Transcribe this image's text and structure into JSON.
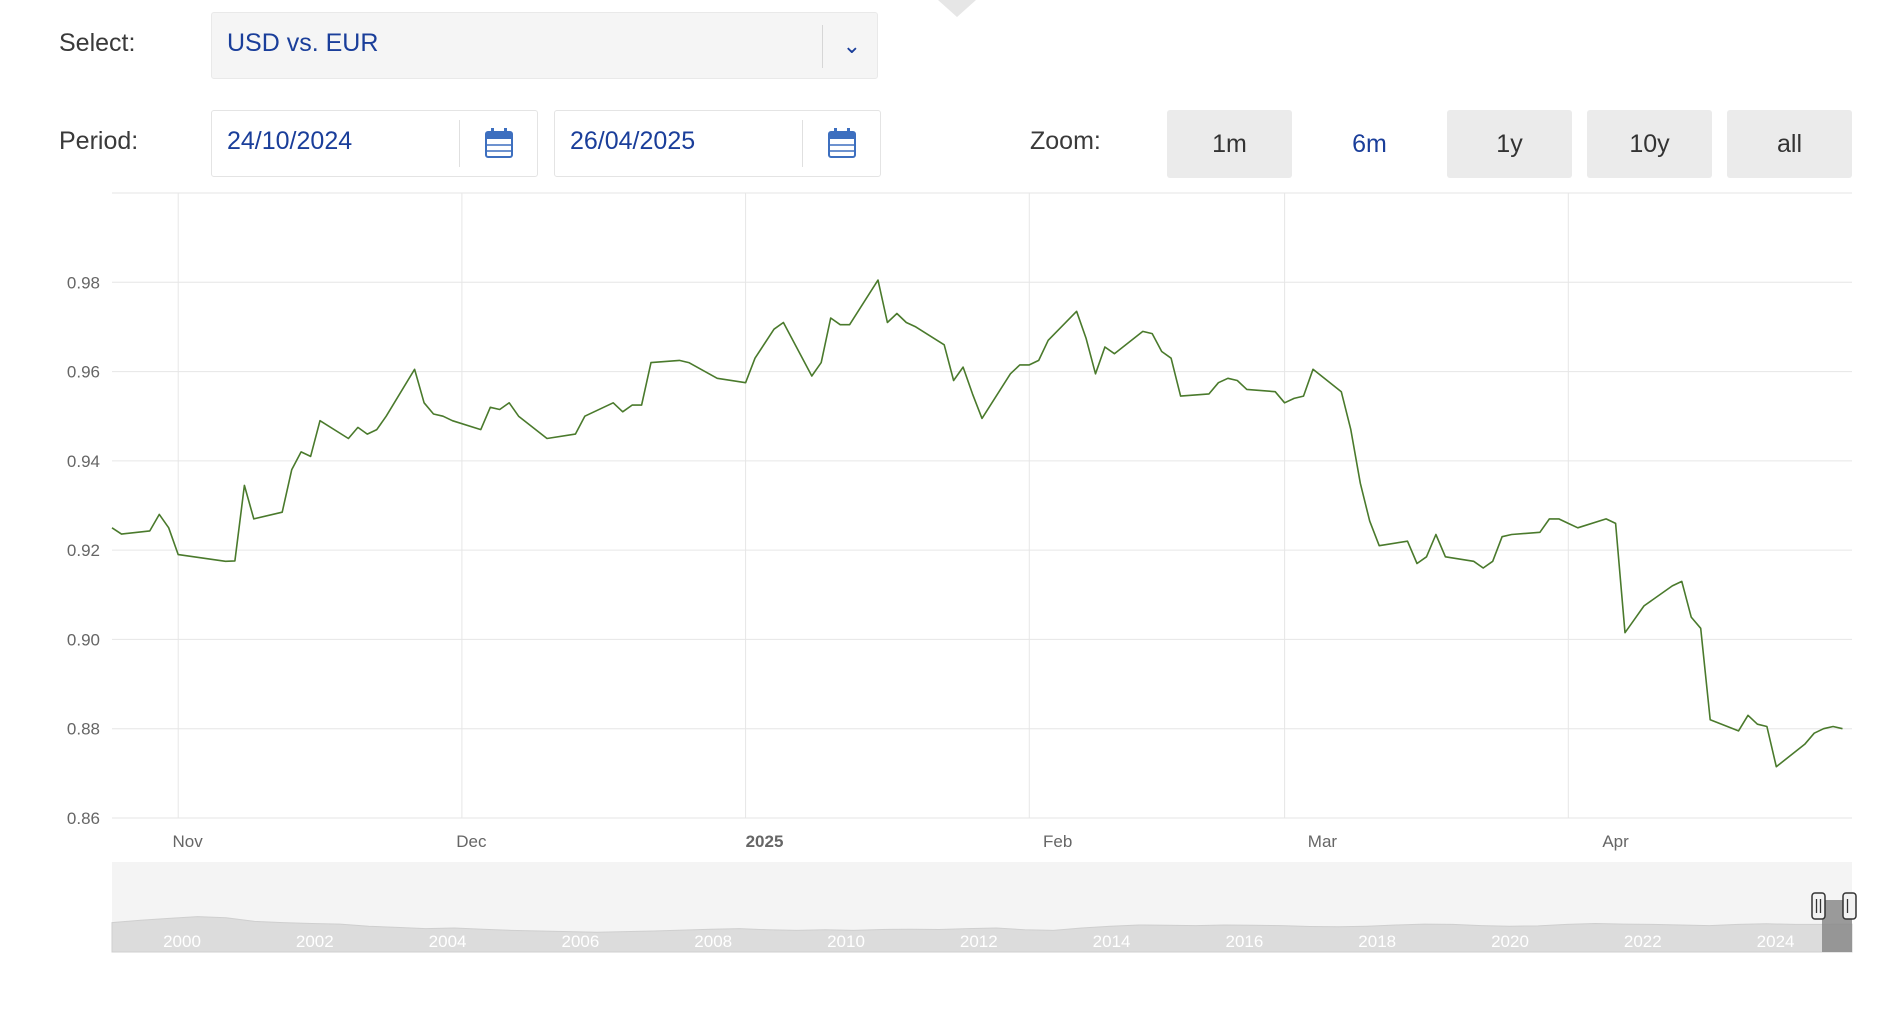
{
  "controls": {
    "select_label": "Select:",
    "select_value": "USD vs. EUR",
    "period_label": "Period:",
    "start_date": "24/10/2024",
    "end_date": "26/04/2025",
    "zoom_label": "Zoom:",
    "zoom_options": [
      "1m",
      "6m",
      "1y",
      "10y",
      "all"
    ],
    "zoom_selected": "6m"
  },
  "colors": {
    "line": "#4a7a2c",
    "accent": "#1a3e9a",
    "button_bg": "#ebebeb",
    "navigator_fill": "#dcdcdc"
  },
  "icons": [
    "chevron-down-icon",
    "calendar-icon"
  ],
  "chart_data": {
    "type": "line",
    "title": "",
    "xlabel": "",
    "ylabel": "",
    "ylim": [
      0.86,
      1.0
    ],
    "yticks": [
      "0.86",
      "0.88",
      "0.90",
      "0.92",
      "0.94",
      "0.96",
      "0.98"
    ],
    "xlim": [
      "2024-10-24",
      "2025-04-26"
    ],
    "xticks": [
      {
        "date": "2024-11-01",
        "label": "Nov",
        "bold": false
      },
      {
        "date": "2024-12-01",
        "label": "Dec",
        "bold": false
      },
      {
        "date": "2025-01-01",
        "label": "2025",
        "bold": true
      },
      {
        "date": "2025-02-01",
        "label": "Feb",
        "bold": false
      },
      {
        "date": "2025-03-01",
        "label": "Mar",
        "bold": false
      },
      {
        "date": "2025-04-01",
        "label": "Apr",
        "bold": false
      }
    ],
    "grid_dates": [
      "2024-10-31",
      "2024-11-30",
      "2024-12-30",
      "2025-01-29",
      "2025-02-25",
      "2025-03-27"
    ],
    "grid": true,
    "series": [
      {
        "x": [
          "2024-10-24",
          "2024-10-25",
          "2024-10-28",
          "2024-10-29",
          "2024-10-30",
          "2024-10-31",
          "2024-11-05",
          "2024-11-06",
          "2024-11-07",
          "2024-11-08",
          "2024-11-11",
          "2024-11-12",
          "2024-11-13",
          "2024-11-14",
          "2024-11-15",
          "2024-11-18",
          "2024-11-19",
          "2024-11-20",
          "2024-11-21",
          "2024-11-22",
          "2024-11-25",
          "2024-11-26",
          "2024-11-27",
          "2024-11-28",
          "2024-11-29",
          "2024-12-02",
          "2024-12-03",
          "2024-12-04",
          "2024-12-05",
          "2024-12-06",
          "2024-12-09",
          "2024-12-12",
          "2024-12-13",
          "2024-12-16",
          "2024-12-17",
          "2024-12-18",
          "2024-12-19",
          "2024-12-20",
          "2024-12-23",
          "2024-12-24",
          "2024-12-27",
          "2024-12-30",
          "2024-12-31",
          "2025-01-02",
          "2025-01-03",
          "2025-01-06",
          "2025-01-07",
          "2025-01-08",
          "2025-01-09",
          "2025-01-10",
          "2025-01-13",
          "2025-01-14",
          "2025-01-15",
          "2025-01-16",
          "2025-01-17",
          "2025-01-20",
          "2025-01-21",
          "2025-01-22",
          "2025-01-23",
          "2025-01-24",
          "2025-01-27",
          "2025-01-28",
          "2025-01-29",
          "2025-01-30",
          "2025-01-31",
          "2025-02-03",
          "2025-02-04",
          "2025-02-05",
          "2025-02-06",
          "2025-02-07",
          "2025-02-10",
          "2025-02-11",
          "2025-02-12",
          "2025-02-13",
          "2025-02-14",
          "2025-02-17",
          "2025-02-18",
          "2025-02-19",
          "2025-02-20",
          "2025-02-21",
          "2025-02-24",
          "2025-02-25",
          "2025-02-26",
          "2025-02-27",
          "2025-02-28",
          "2025-03-03",
          "2025-03-04",
          "2025-03-05",
          "2025-03-06",
          "2025-03-07",
          "2025-03-10",
          "2025-03-11",
          "2025-03-12",
          "2025-03-13",
          "2025-03-14",
          "2025-03-17",
          "2025-03-18",
          "2025-03-19",
          "2025-03-20",
          "2025-03-21",
          "2025-03-24",
          "2025-03-25",
          "2025-03-26",
          "2025-03-27",
          "2025-03-28",
          "2025-03-31",
          "2025-04-01",
          "2025-04-02",
          "2025-04-03",
          "2025-04-04",
          "2025-04-07",
          "2025-04-08",
          "2025-04-09",
          "2025-04-10",
          "2025-04-11",
          "2025-04-14",
          "2025-04-15",
          "2025-04-16",
          "2025-04-17",
          "2025-04-18",
          "2025-04-21",
          "2025-04-22",
          "2025-04-23",
          "2025-04-24",
          "2025-04-25"
        ],
        "values": [
          0.925,
          0.9236,
          0.9243,
          0.928,
          0.925,
          0.919,
          0.9175,
          0.9176,
          0.9345,
          0.927,
          0.9285,
          0.938,
          0.942,
          0.941,
          0.949,
          0.945,
          0.9475,
          0.946,
          0.947,
          0.95,
          0.9605,
          0.953,
          0.9505,
          0.95,
          0.949,
          0.947,
          0.952,
          0.9515,
          0.953,
          0.95,
          0.945,
          0.946,
          0.95,
          0.953,
          0.951,
          0.9525,
          0.9525,
          0.962,
          0.9625,
          0.962,
          0.9585,
          0.9575,
          0.963,
          0.9695,
          0.971,
          0.959,
          0.962,
          0.972,
          0.9705,
          0.9705,
          0.9805,
          0.971,
          0.973,
          0.971,
          0.97,
          0.966,
          0.958,
          0.961,
          0.955,
          0.9495,
          0.9595,
          0.9615,
          0.9615,
          0.9625,
          0.967,
          0.9735,
          0.9675,
          0.9595,
          0.9655,
          0.964,
          0.969,
          0.9685,
          0.9645,
          0.963,
          0.9545,
          0.955,
          0.9575,
          0.9585,
          0.958,
          0.956,
          0.9555,
          0.953,
          0.954,
          0.9545,
          0.9605,
          0.9555,
          0.947,
          0.935,
          0.9265,
          0.921,
          0.922,
          0.917,
          0.9185,
          0.9235,
          0.9185,
          0.9175,
          0.916,
          0.9175,
          0.923,
          0.9235,
          0.924,
          0.927,
          0.927,
          0.926,
          0.925,
          0.927,
          0.926,
          0.9015,
          0.9045,
          0.9075,
          0.912,
          0.913,
          0.905,
          0.9025,
          0.882,
          0.8795,
          0.883,
          0.881,
          0.8805,
          0.8715,
          0.8765,
          0.879,
          0.88,
          0.8805,
          0.88
        ]
      }
    ],
    "navigator": {
      "tick_labels": [
        "2000",
        "2002",
        "2004",
        "2006",
        "2008",
        "2010",
        "2012",
        "2014",
        "2016",
        "2018",
        "2020",
        "2022",
        "2024"
      ],
      "series_values": [
        0.98,
        1.06,
        1.12,
        1.18,
        1.14,
        1.02,
        0.98,
        0.95,
        0.93,
        0.86,
        0.82,
        0.78,
        0.8,
        0.76,
        0.72,
        0.7,
        0.68,
        0.66,
        0.68,
        0.7,
        0.73,
        0.76,
        0.78,
        0.74,
        0.72,
        0.74,
        0.72,
        0.75,
        0.76,
        0.75,
        0.78,
        0.8,
        0.74,
        0.72,
        0.8,
        0.86,
        0.9,
        0.89,
        0.88,
        0.9,
        0.89,
        0.88,
        0.85,
        0.84,
        0.86,
        0.9,
        0.93,
        0.92,
        0.88,
        0.86,
        0.87,
        0.92,
        0.95,
        0.93,
        0.92,
        0.9,
        0.88,
        0.92,
        0.94,
        0.92,
        0.92,
        0.93
      ]
    }
  }
}
